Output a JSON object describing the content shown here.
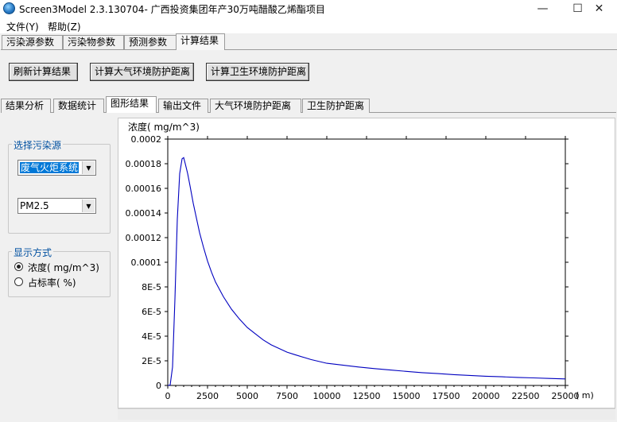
{
  "window": {
    "title": "Screen3Model 2.3.130704- 广西投资集团年产30万吨醋酸乙烯酯项目",
    "minimize": "—",
    "maximize": "☐",
    "close": "✕"
  },
  "menu": [
    "文件(Y)",
    "帮助(Z)"
  ],
  "outer_tabs": [
    "污染源参数",
    "污染物参数",
    "预测参数",
    "计算结果"
  ],
  "outer_active": "计算结果",
  "buttons": {
    "refresh": "刷新计算结果",
    "atmo": "计算大气环境防护距离",
    "health": "计算卫生环境防护距离"
  },
  "inner_tabs": [
    "结果分析",
    "数据统计",
    "图形结果",
    "输出文件",
    "大气环境防护距离",
    "卫生防护距离"
  ],
  "inner_active": "图形结果",
  "source_group": {
    "title": "选择污染源",
    "source_value": "废气火炬系统",
    "pollutant_value": "PM2.5"
  },
  "display_group": {
    "title": "显示方式",
    "options": [
      {
        "label": "浓度( mg/m^3)",
        "checked": true
      },
      {
        "label": "占标率( %)",
        "checked": false
      }
    ]
  },
  "chart_data": {
    "type": "line",
    "ylabel": "浓度( mg/m^3)",
    "xunit": "( m)",
    "xlim": [
      0,
      25000
    ],
    "ylim": [
      0,
      0.0002
    ],
    "xticks": [
      "0",
      "2500",
      "5000",
      "7500",
      "10000",
      "12500",
      "15000",
      "17500",
      "20000",
      "22500",
      "25000"
    ],
    "yticks": [
      "0",
      "2E-5",
      "4E-5",
      "6E-5",
      "8E-5",
      "0.0001",
      "0.00012",
      "0.00014",
      "0.00016",
      "0.00018",
      "0.0002"
    ],
    "series": [
      {
        "color": "#0000c0",
        "x": [
          0,
          150,
          300,
          450,
          600,
          750,
          900,
          1000,
          1100,
          1250,
          1400,
          1600,
          1800,
          2000,
          2250,
          2500,
          2750,
          3000,
          3500,
          4000,
          4500,
          5000,
          5500,
          6000,
          6500,
          7000,
          7500,
          8000,
          9000,
          10000,
          11000,
          12000,
          13000,
          14000,
          15000,
          16000,
          17000,
          18000,
          19000,
          20000,
          21000,
          22000,
          23000,
          24000,
          25000
        ],
        "y": [
          0,
          3e-07,
          1.5e-05,
          7e-05,
          0.000135,
          0.000172,
          0.000184,
          0.000185,
          0.00018,
          0.000172,
          0.000162,
          0.000148,
          0.000136,
          0.000124,
          0.000112,
          0.000101,
          9.2e-05,
          8.4e-05,
          7.2e-05,
          6.2e-05,
          5.4e-05,
          4.7e-05,
          4.2e-05,
          3.7e-05,
          3.3e-05,
          3e-05,
          2.7e-05,
          2.5e-05,
          2.1e-05,
          1.8e-05,
          1.65e-05,
          1.5e-05,
          1.37e-05,
          1.25e-05,
          1.14e-05,
          1.04e-05,
          9.6e-06,
          8.8e-06,
          8.1e-06,
          7.5e-06,
          7e-06,
          6.5e-06,
          6.1e-06,
          5.7e-06,
          5.3e-06
        ]
      }
    ]
  }
}
